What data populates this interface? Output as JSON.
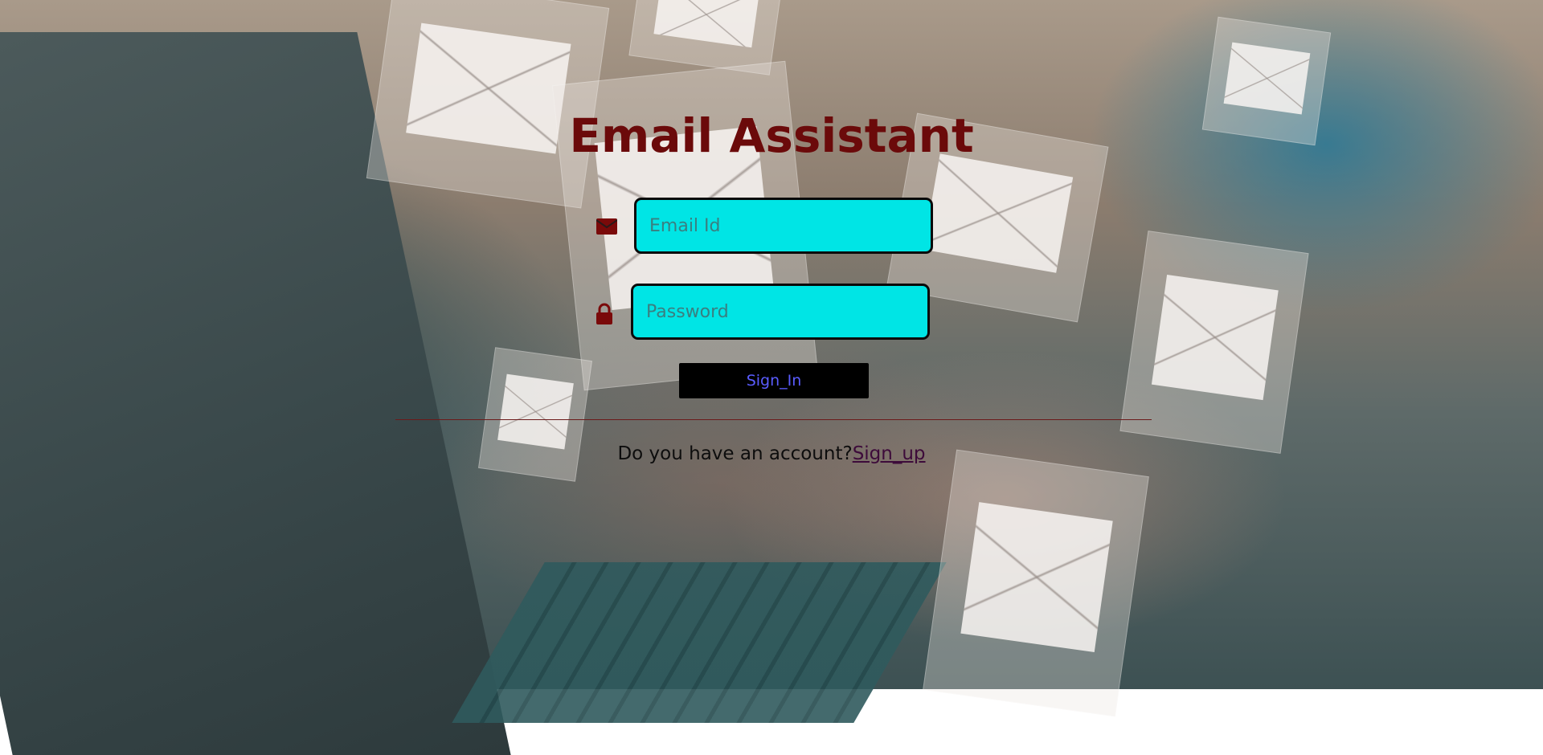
{
  "page": {
    "title": "Email Assistant",
    "title_color": "#6b0a0a"
  },
  "form": {
    "email_placeholder": "Email Id",
    "password_placeholder": "Password",
    "email_icon": "envelope-icon",
    "password_icon": "lock-icon",
    "field_color": "#00e5e5",
    "signin_label": "Sign_In",
    "signin_bg": "#000000",
    "signin_text_color": "#5a5cff"
  },
  "footer": {
    "question": "Do you have an account?",
    "signup_label": "Sign_up"
  }
}
